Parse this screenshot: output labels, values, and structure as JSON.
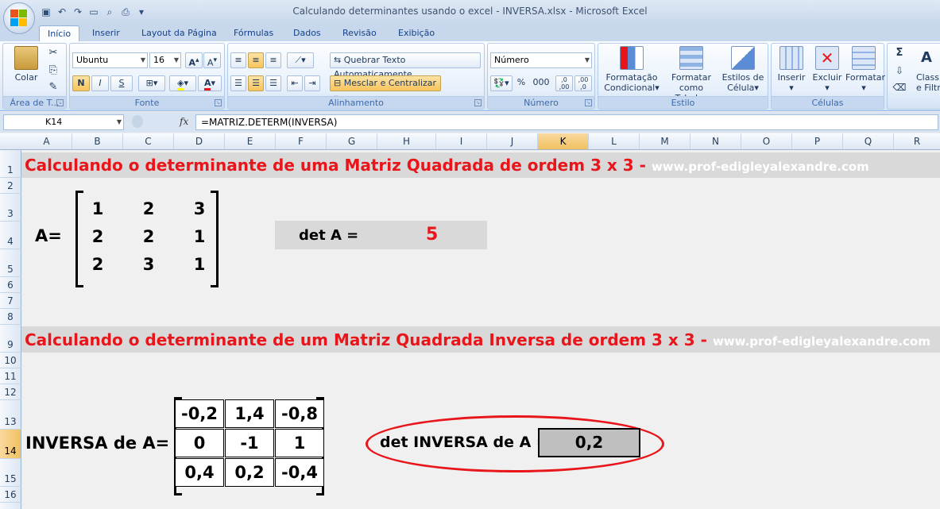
{
  "window": {
    "title": "Calculando determinantes usando o excel - INVERSA.xlsx - Microsoft Excel"
  },
  "ribbon": {
    "tabs": [
      "Início",
      "Inserir",
      "Layout da Página",
      "Fórmulas",
      "Dados",
      "Revisão",
      "Exibição"
    ],
    "active_tab": "Início",
    "clipboard": {
      "paste_label": "Colar",
      "group_label": "Área de T..."
    },
    "font": {
      "family": "Ubuntu",
      "size": "16",
      "bold": "N",
      "italic": "I",
      "underline": "S",
      "group_label": "Fonte"
    },
    "alignment": {
      "wrap_text": "Quebrar Texto Automaticamente",
      "merge_center": "Mesclar e Centralizar",
      "group_label": "Alinhamento"
    },
    "number": {
      "format": "Número",
      "percent": "%",
      "thousands": "000",
      "group_label": "Número"
    },
    "styles": {
      "conditional_1": "Formatação",
      "conditional_2": "Condicional",
      "table_1": "Formatar",
      "table_2": "como Tabela",
      "cell_1": "Estilos de",
      "cell_2": "Célula",
      "group_label": "Estilo"
    },
    "cells": {
      "insert": "Inserir",
      "delete": "Excluir",
      "format": "Formatar",
      "group_label": "Células"
    },
    "editing": {
      "sort_1": "Classi",
      "sort_2": "e Filtr",
      "sigma": "Σ"
    }
  },
  "formula_bar": {
    "cell_ref": "K14",
    "fx": "fx",
    "formula": "=MATRIZ.DETERM(INVERSA)"
  },
  "grid": {
    "columns": [
      "A",
      "B",
      "C",
      "D",
      "E",
      "F",
      "G",
      "H",
      "I",
      "J",
      "K",
      "L",
      "M",
      "N",
      "O",
      "P",
      "Q",
      "R"
    ],
    "rows": [
      "1",
      "2",
      "3",
      "4",
      "5",
      "6",
      "7",
      "8",
      "9",
      "10",
      "11",
      "12",
      "13",
      "14",
      "15",
      "16"
    ],
    "selected_column": "K",
    "selected_row": "14"
  },
  "sheet": {
    "heading1": "Calculando o determinante de uma Matriz Quadrada de ordem 3 x 3 -",
    "heading1_site": "www.prof-edigleyalexandre.com",
    "matrix_label": "A=",
    "matrix": [
      [
        "1",
        "2",
        "3"
      ],
      [
        "2",
        "2",
        "1"
      ],
      [
        "2",
        "3",
        "1"
      ]
    ],
    "det_label": "det A =",
    "det_value": "5",
    "heading2": "Calculando o determinante de um Matriz Quadrada Inversa de ordem 3 x 3 -",
    "heading2_site": "www.prof-edigleyalexandre.com",
    "inverse_label": "INVERSA de A=",
    "inverse": [
      [
        "-0,2",
        "1,4",
        "-0,8"
      ],
      [
        "0",
        "-1",
        "1"
      ],
      [
        "0,4",
        "0,2",
        "-0,4"
      ]
    ],
    "det_inverse_label": "det INVERSA de A =",
    "det_inverse_value": "0,2"
  },
  "colors": {
    "heading_red": "#e8161b",
    "band_gray": "#d9d9d9",
    "oval_red": "#e8161b"
  }
}
